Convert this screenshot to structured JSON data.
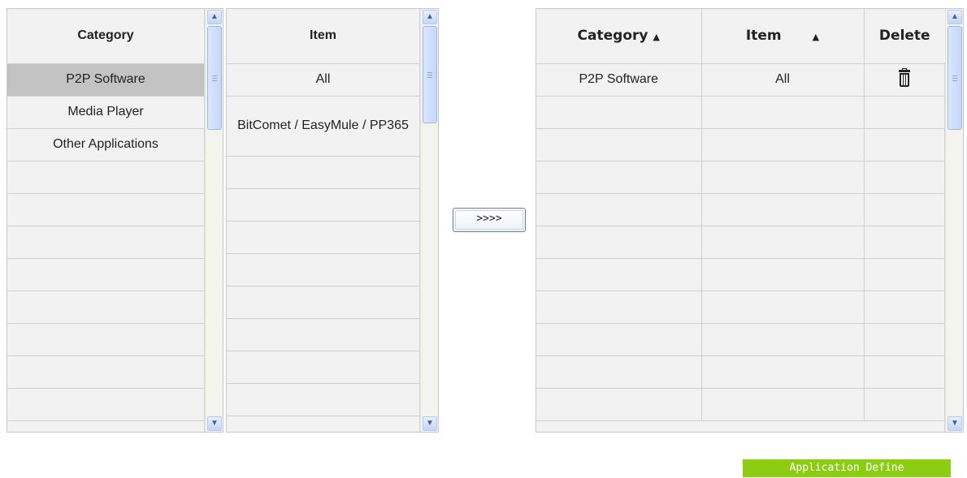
{
  "category_list": {
    "header": "Category",
    "items": [
      "P2P Software",
      "Media Player",
      "Other Applications",
      "",
      "",
      "",
      "",
      "",
      "",
      "",
      "",
      ""
    ],
    "selected_index": 0
  },
  "item_list": {
    "header": "Item",
    "items": [
      "All",
      "BitComet / EasyMule / PP365",
      "",
      "",
      "",
      "",
      "",
      "",
      "",
      "",
      ""
    ]
  },
  "move_button": {
    "label": ">>>>"
  },
  "selected_table": {
    "headers": {
      "category": "Category",
      "item": "Item",
      "delete": "Delete"
    },
    "sort_arrow": "▲",
    "rows": [
      {
        "category": "P2P Software",
        "item": "All",
        "delete_icon": "trash-icon"
      },
      {
        "category": "",
        "item": "",
        "delete_icon": ""
      },
      {
        "category": "",
        "item": "",
        "delete_icon": ""
      },
      {
        "category": "",
        "item": "",
        "delete_icon": ""
      },
      {
        "category": "",
        "item": "",
        "delete_icon": ""
      },
      {
        "category": "",
        "item": "",
        "delete_icon": ""
      },
      {
        "category": "",
        "item": "",
        "delete_icon": ""
      },
      {
        "category": "",
        "item": "",
        "delete_icon": ""
      },
      {
        "category": "",
        "item": "",
        "delete_icon": ""
      },
      {
        "category": "",
        "item": "",
        "delete_icon": ""
      },
      {
        "category": "",
        "item": "",
        "delete_icon": ""
      }
    ]
  },
  "footer": {
    "define_button": "Application Define"
  },
  "colors": {
    "selected_row": "#c3c3c3",
    "panel_bg": "#f2f2f2",
    "define_button_bg": "#8ccd13"
  }
}
